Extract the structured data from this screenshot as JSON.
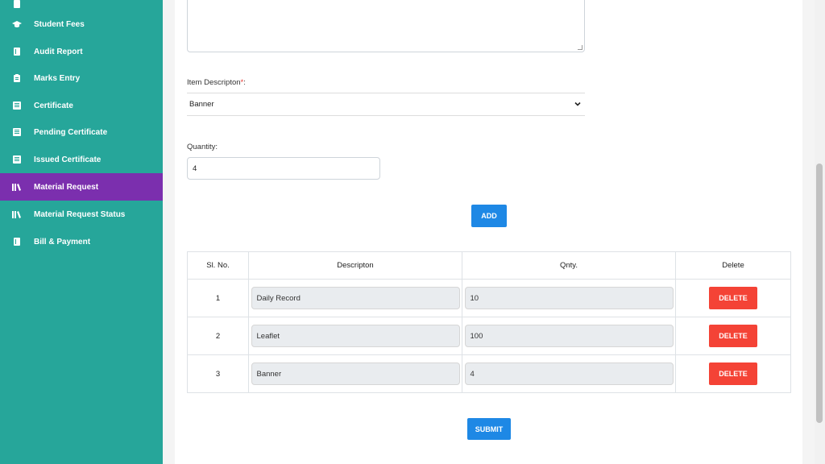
{
  "sidebar": {
    "items": [
      {
        "label": "",
        "icon": "book-icon"
      },
      {
        "label": "Student Fees",
        "icon": "graduation-cap-icon"
      },
      {
        "label": "Audit Report",
        "icon": "book-icon"
      },
      {
        "label": "Marks Entry",
        "icon": "clipboard-icon"
      },
      {
        "label": "Certificate",
        "icon": "certificate-icon"
      },
      {
        "label": "Pending Certificate",
        "icon": "certificate-icon"
      },
      {
        "label": "Issued Certificate",
        "icon": "certificate-icon"
      },
      {
        "label": "Material Request",
        "icon": "library-icon",
        "active": true
      },
      {
        "label": "Material Request Status",
        "icon": "library-icon"
      },
      {
        "label": "Bill & Payment",
        "icon": "book-icon"
      }
    ],
    "bg_color": "#26a69a",
    "active_color": "#7b2fae"
  },
  "form": {
    "item_description_label": "Item Descripton",
    "required_mark": "*",
    "label_colon": ":",
    "item_description_value": "Banner",
    "quantity_label": "Quantity:",
    "quantity_value": "4",
    "add_label": "ADD",
    "submit_label": "SUBMIT"
  },
  "table": {
    "headers": [
      "Sl. No.",
      "Descripton",
      "Qnty.",
      "Delete"
    ],
    "rows": [
      {
        "sl": "1",
        "description": "Daily Record",
        "qty": "10",
        "action": "DELETE"
      },
      {
        "sl": "2",
        "description": "Leaflet",
        "qty": "100",
        "action": "DELETE"
      },
      {
        "sl": "3",
        "description": "Banner",
        "qty": "4",
        "action": "DELETE"
      }
    ]
  },
  "colors": {
    "primary": "#1e88e5",
    "danger": "#f44336"
  }
}
